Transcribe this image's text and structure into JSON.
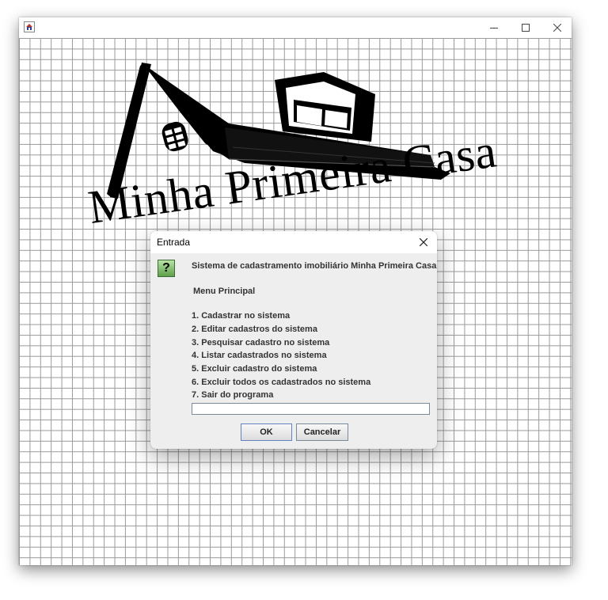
{
  "window": {
    "title": "",
    "icons": {
      "app": "java-cup-icon",
      "minimize": "minimize-icon",
      "maximize": "maximize-icon",
      "close": "close-icon"
    }
  },
  "logo": {
    "text": "Minha Primeira Casa"
  },
  "dialog": {
    "title": "Entrada",
    "icon": "question-icon",
    "icon_glyph": "?",
    "heading": "Sistema de cadastramento imobiliário Minha Primeira Casa",
    "menu_title": "Menu Principal",
    "options": [
      "1. Cadastrar no sistema",
      "2. Editar cadastros do sistema",
      "3. Pesquisar cadastro no sistema",
      "4. Listar cadastrados no sistema",
      "5. Excluir cadastro do sistema",
      "6. Excluir todos os cadastrados no sistema",
      "7. Sair do programa"
    ],
    "input_value": "",
    "ok_label": "OK",
    "cancel_label": "Cancelar"
  }
}
